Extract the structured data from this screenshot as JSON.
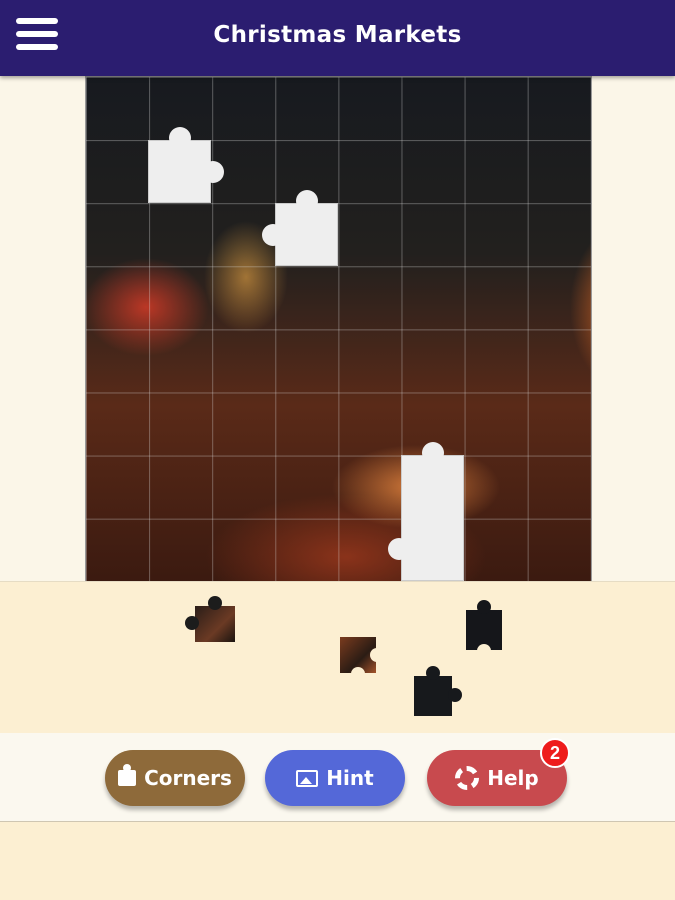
{
  "header": {
    "title": "Christmas Markets",
    "menu_icon": "hamburger-menu-icon"
  },
  "puzzle": {
    "grid": "8x8",
    "missing_slots": 3,
    "tray_pieces": 4
  },
  "toolbar": {
    "corners_label": "Corners",
    "hint_label": "Hint",
    "help_label": "Help",
    "help_badge": "2",
    "corners_icon": "puzzle-piece-icon",
    "hint_icon": "image-icon",
    "help_icon": "lifebuoy-icon"
  },
  "colors": {
    "header_bg": "#2b1d70",
    "corners_bg": "#8e6a3a",
    "hint_bg": "#5468d8",
    "help_bg": "#c84a4e",
    "badge_bg": "#ee1c1c",
    "tray_bg": "#fcefd2"
  }
}
